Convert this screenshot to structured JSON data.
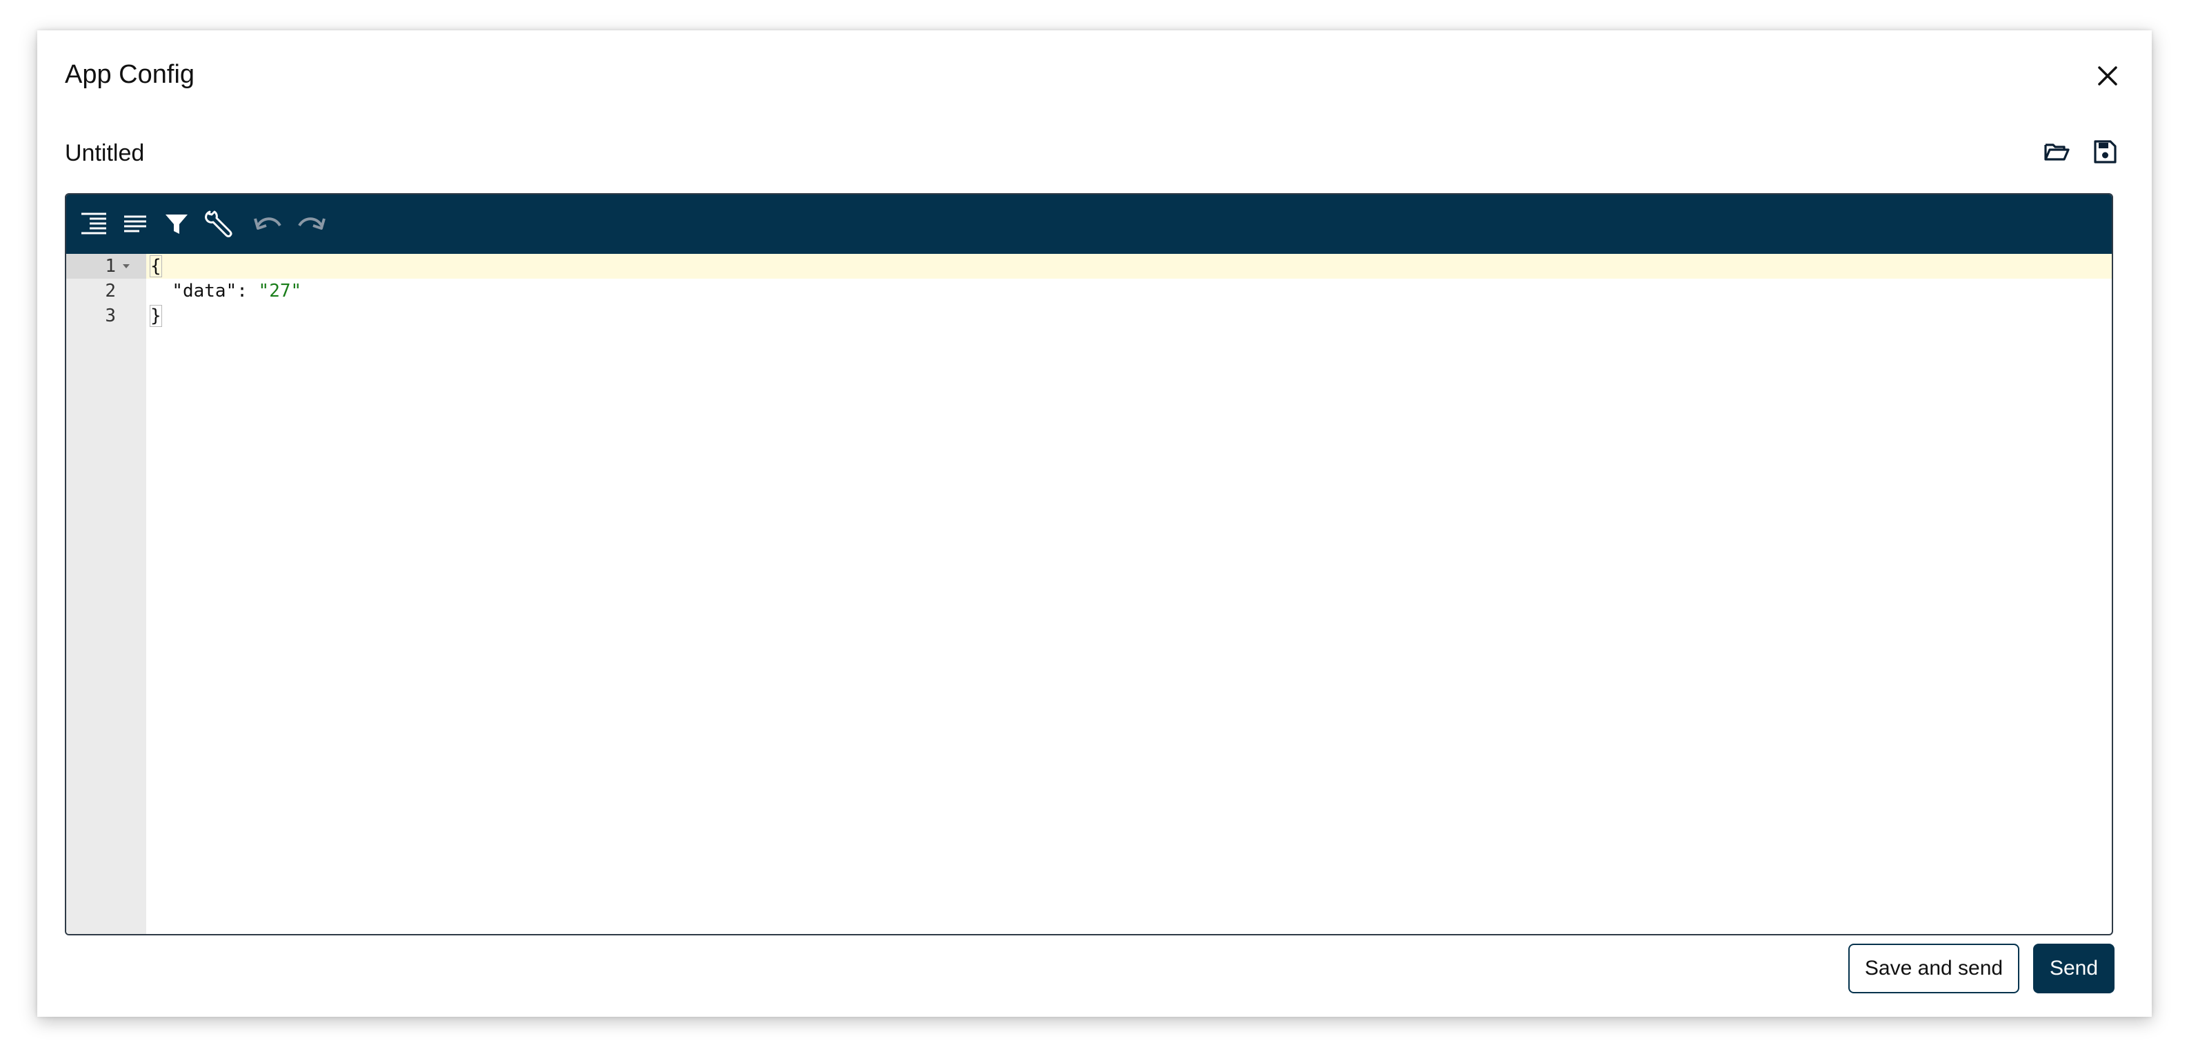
{
  "dialog": {
    "title": "App Config"
  },
  "file": {
    "name": "Untitled",
    "open_icon": "folder-open-icon",
    "save_icon": "floppy-save-icon"
  },
  "toolbar": {
    "icons": [
      "format-indent-icon",
      "compact-icon",
      "filter-icon",
      "repair-wrench-icon",
      "undo-icon",
      "redo-icon"
    ]
  },
  "editor": {
    "line_numbers": [
      "1",
      "2",
      "3"
    ],
    "line1": "{",
    "line2_key": "\"data\"",
    "line2_colon": ": ",
    "line2_value": "\"27\"",
    "line3": "}"
  },
  "footer": {
    "save_and_send_label": "Save and send",
    "send_label": "Send"
  },
  "colors": {
    "toolbar_bg": "#04324d",
    "primary_button": "#04324d",
    "active_line": "#fffadd",
    "string_value": "#1a7d1a"
  }
}
